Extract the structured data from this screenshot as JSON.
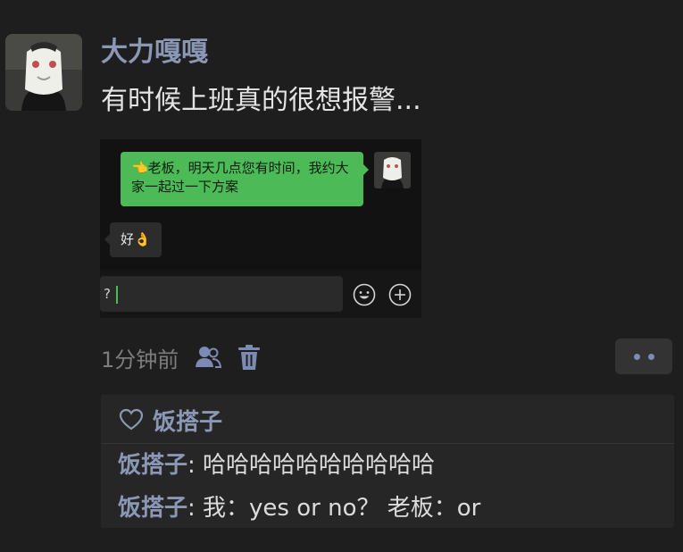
{
  "post": {
    "author": "大力嘎嘎",
    "text": "有时候上班真的很想报警...",
    "timestamp": "1分钟前"
  },
  "embedded_chat": {
    "sent_message": "👈老板，明天几点您有时间，我约大家一起过一下方案",
    "reply_message": "好👌",
    "input_text": "?"
  },
  "likes": {
    "names": "饭搭子"
  },
  "comments": [
    {
      "author": "饭搭子",
      "separator": ": ",
      "text": "哈哈哈哈哈哈哈哈哈哈"
    },
    {
      "author": "饭搭子",
      "separator": ": ",
      "text": "我：yes or no？ 老板：or"
    }
  ],
  "colors": {
    "background": "#1e1e1e",
    "name_accent": "#8a97b5",
    "chat_green": "#4cbb57"
  },
  "icons": [
    "friends-icon",
    "trash-icon",
    "more-dots-icon",
    "heart-icon",
    "emoji-icon",
    "plus-circle-icon"
  ]
}
